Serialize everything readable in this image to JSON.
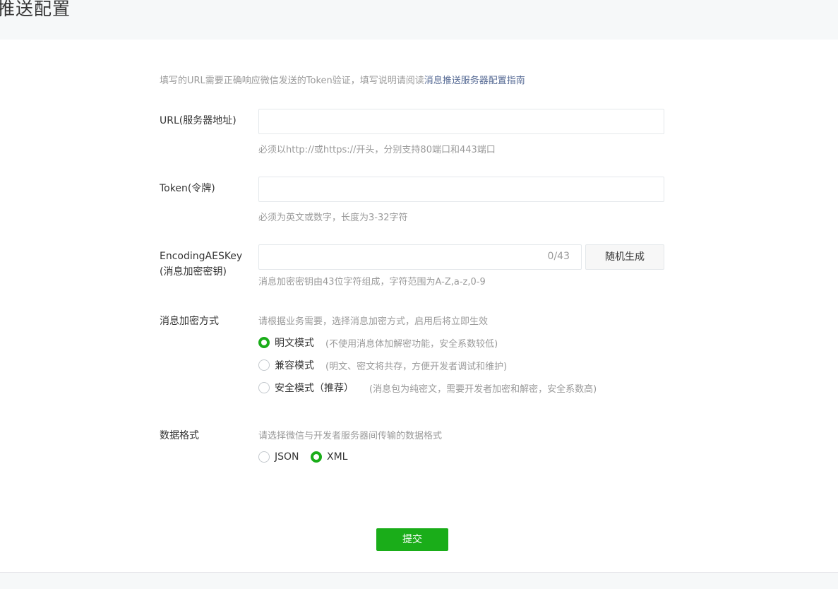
{
  "page": {
    "title": "推送配置"
  },
  "intro": {
    "text": "填写的URL需要正确响应微信发送的Token验证，填写说明请阅读",
    "link": "消息推送服务器配置指南"
  },
  "fields": {
    "url": {
      "label": "URL(服务器地址)",
      "value": "",
      "hint": "必须以http://或https://开头，分别支持80端口和443端口"
    },
    "token": {
      "label": "Token(令牌)",
      "value": "",
      "hint": "必须为英文或数字，长度为3-32字符"
    },
    "aes_key": {
      "label_line1": "EncodingAESKey",
      "label_line2": "(消息加密密钥)",
      "value": "",
      "counter": "0/43",
      "generate_label": "随机生成",
      "hint": "消息加密密钥由43位字符组成，字符范围为A-Z,a-z,0-9"
    }
  },
  "encryption": {
    "label": "消息加密方式",
    "hint": "请根据业务需要，选择消息加密方式，启用后将立即生效",
    "options": [
      {
        "label": "明文模式",
        "desc": "(不使用消息体加解密功能，安全系数较低)",
        "checked": true
      },
      {
        "label": "兼容模式",
        "desc": "(明文、密文将共存，方便开发者调试和维护)",
        "checked": false
      },
      {
        "label": "安全模式（推荐）",
        "desc": "(消息包为纯密文，需要开发者加密和解密，安全系数高)",
        "checked": false
      }
    ]
  },
  "format": {
    "label": "数据格式",
    "hint": "请选择微信与开发者服务器间传输的数据格式",
    "options": [
      {
        "label": "JSON",
        "checked": false
      },
      {
        "label": "XML",
        "checked": true
      }
    ]
  },
  "submit_label": "提交",
  "colors": {
    "accent": "#1aad19",
    "link": "#576b95",
    "hint": "#9a9a9a"
  }
}
